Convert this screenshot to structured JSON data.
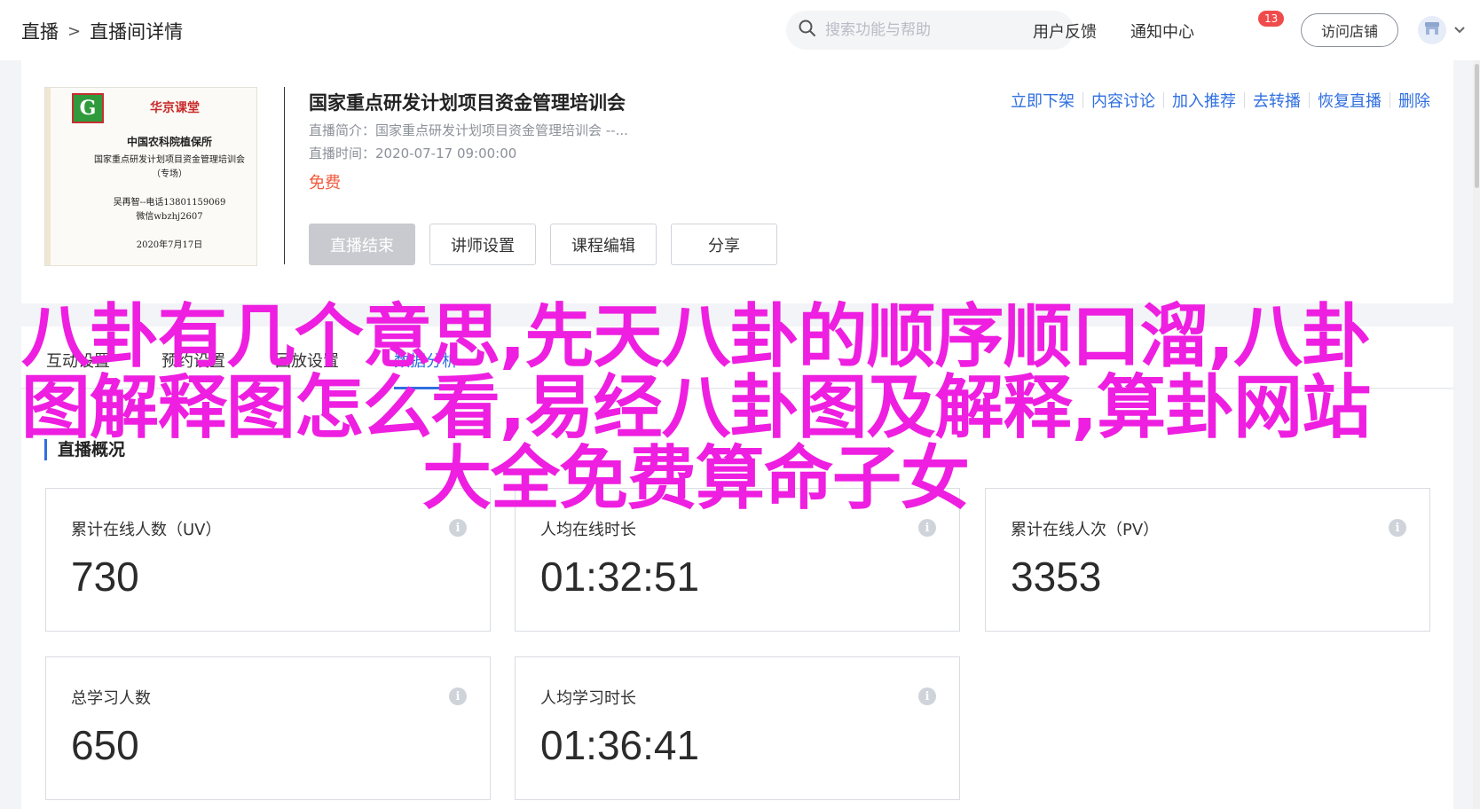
{
  "breadcrumb": {
    "root": "直播",
    "separator": ">",
    "current": "直播间详情"
  },
  "search": {
    "placeholder": "搜索功能与帮助"
  },
  "topbar": {
    "feedback": "用户反馈",
    "notifications": "通知中心",
    "notification_count": "13",
    "visit_store": "访问店铺"
  },
  "cover": {
    "brand": "华京课堂",
    "org": "中国农科院植保所",
    "subtitle": "国家重点研发计划项目资金管理培训会",
    "tag": "（专场）",
    "contact": "吴再智--电话13801159069",
    "wechat": "微信wbzhj2607",
    "date": "2020年7月17日"
  },
  "course": {
    "title": "国家重点研发计划项目资金管理培训会",
    "intro": "直播简介：国家重点研发计划项目资金管理培训会 --...",
    "time": "直播时间：2020-07-17 09:00:00",
    "price": "免费"
  },
  "buttons": {
    "end_live": "直播结束",
    "lecturer": "讲师设置",
    "edit_course": "课程编辑",
    "share": "分享"
  },
  "actions": [
    "立即下架",
    "内容讨论",
    "加入推荐",
    "去转播",
    "恢复直播",
    "删除"
  ],
  "tabs": [
    "互动设置",
    "预约设置",
    "回放设置",
    "数据分析"
  ],
  "overview": {
    "title": "直播概况",
    "stats": [
      {
        "label": "累计在线人数（UV）",
        "value": "730"
      },
      {
        "label": "人均在线时长",
        "value": "01:32:51"
      },
      {
        "label": "累计在线人次（PV）",
        "value": "3353"
      },
      {
        "label": "总学习人数",
        "value": "650"
      },
      {
        "label": "人均学习时长",
        "value": "01:36:41"
      }
    ]
  },
  "overlay": {
    "line1": "八卦有几个意思,先天八卦的顺序顺口溜,八卦",
    "line2": "图解释图怎么看,易经八卦图及解释,算卦网站",
    "line3": "大全免费算命子女"
  },
  "colors": {
    "accent": "#2f6fdf",
    "overlay": "#ee1fe0",
    "price": "#f05a3c",
    "badge": "#f04b4b"
  }
}
